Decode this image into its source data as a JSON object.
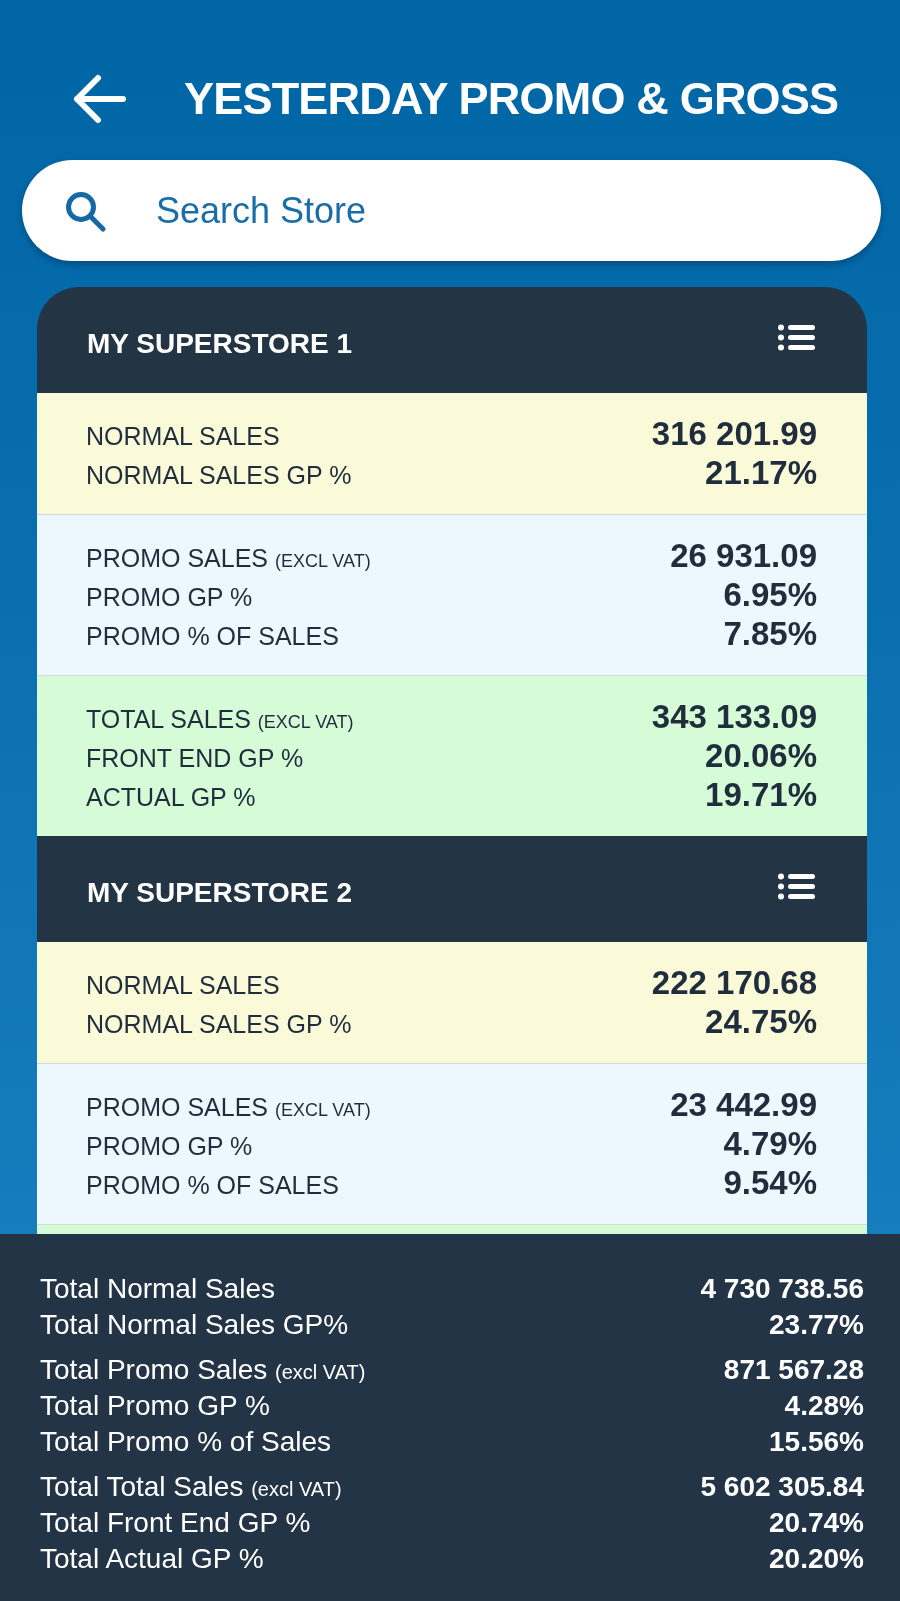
{
  "title": "YESTERDAY PROMO & GROSS",
  "search": {
    "placeholder": "Search Store"
  },
  "stores": [
    {
      "name": "MY SUPERSTORE 1",
      "sections": [
        {
          "kind": "normal",
          "rows": [
            {
              "label": "NORMAL SALES",
              "value": "316 201.99"
            },
            {
              "label": "NORMAL SALES GP %",
              "value": "21.17%"
            }
          ]
        },
        {
          "kind": "promo",
          "rows": [
            {
              "label": "PROMO SALES",
              "note": "(EXCL VAT)",
              "value": "26 931.09"
            },
            {
              "label": "PROMO GP %",
              "value": "6.95%"
            },
            {
              "label": "PROMO % OF SALES",
              "value": "7.85%"
            }
          ]
        },
        {
          "kind": "total",
          "rows": [
            {
              "label": "TOTAL SALES",
              "note": "(EXCL VAT)",
              "value": "343 133.09"
            },
            {
              "label": "FRONT END GP %",
              "value": "20.06%"
            },
            {
              "label": "ACTUAL GP %",
              "value": "19.71%"
            }
          ]
        }
      ]
    },
    {
      "name": "MY SUPERSTORE 2",
      "sections": [
        {
          "kind": "normal",
          "rows": [
            {
              "label": "NORMAL SALES",
              "value": "222 170.68"
            },
            {
              "label": "NORMAL SALES GP %",
              "value": "24.75%"
            }
          ]
        },
        {
          "kind": "promo",
          "rows": [
            {
              "label": "PROMO SALES",
              "note": "(EXCL VAT)",
              "value": "23 442.99"
            },
            {
              "label": "PROMO GP %",
              "value": "4.79%"
            },
            {
              "label": "PROMO % OF SALES",
              "value": "9.54%"
            }
          ]
        },
        {
          "kind": "total"
        }
      ]
    }
  ],
  "totals": [
    {
      "rows": [
        {
          "label": "Total Normal Sales",
          "value": "4 730 738.56"
        },
        {
          "label": "Total Normal Sales GP%",
          "value": "23.77%"
        }
      ]
    },
    {
      "rows": [
        {
          "label": "Total Promo Sales",
          "note": "(excl VAT)",
          "value": "871 567.28"
        },
        {
          "label": "Total Promo GP %",
          "value": "4.28%"
        },
        {
          "label": "Total Promo % of Sales",
          "value": "15.56%"
        }
      ]
    },
    {
      "rows": [
        {
          "label": "Total Total Sales",
          "note": "(excl VAT)",
          "value": "5 602 305.84"
        },
        {
          "label": "Total Front End GP %",
          "value": "20.74%"
        },
        {
          "label": "Total Actual GP %",
          "value": "20.20%"
        }
      ]
    }
  ]
}
